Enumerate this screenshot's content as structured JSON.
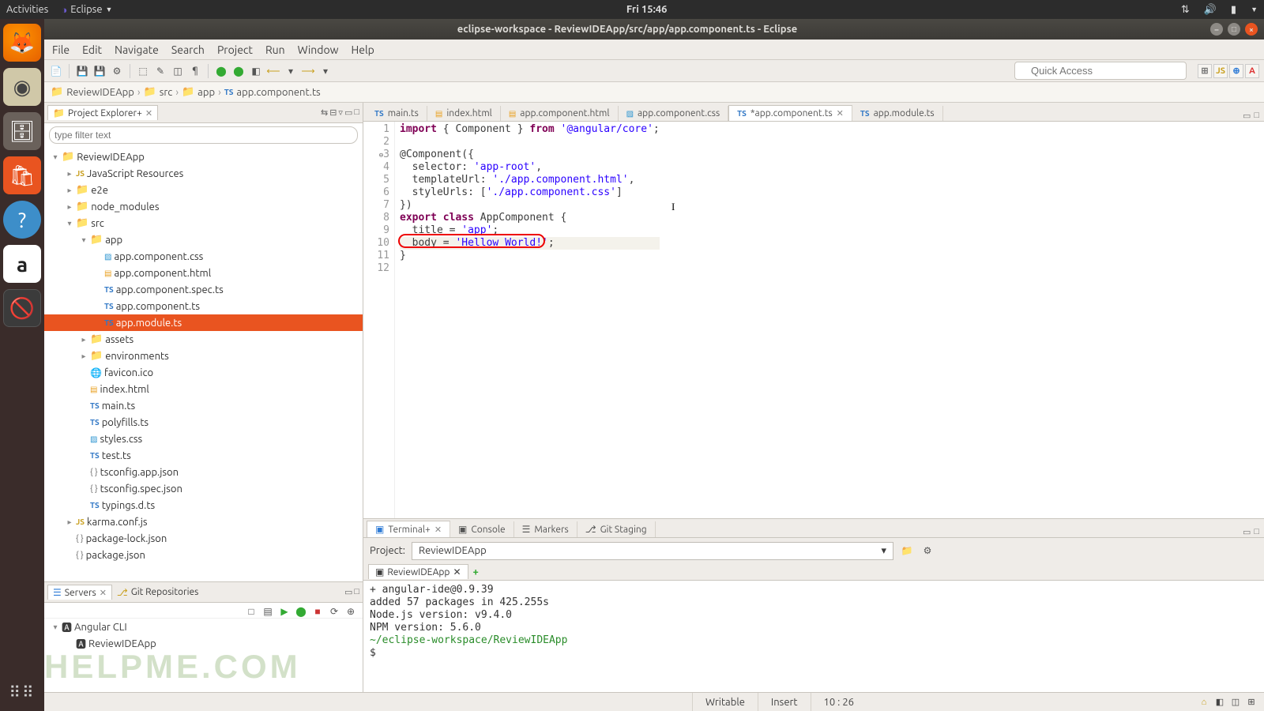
{
  "gnome": {
    "activities": "Activities",
    "app_indicator": "Eclipse",
    "clock": "Fri 15:46"
  },
  "titlebar": "eclipse-workspace - ReviewIDEApp/src/app/app.component.ts - Eclipse",
  "menubar": [
    "File",
    "Edit",
    "Navigate",
    "Search",
    "Project",
    "Run",
    "Window",
    "Help"
  ],
  "quick_access": "Quick Access",
  "perspectives": [
    "⊞",
    "JS",
    "⊕",
    "A"
  ],
  "breadcrumb": [
    "ReviewIDEApp",
    "src",
    "app",
    "app.component.ts"
  ],
  "project_explorer": {
    "label": "Project Explorer+",
    "filter_placeholder": "type filter text",
    "tree": [
      {
        "d": 0,
        "tw": "▾",
        "ic": "fold",
        "t": "ReviewIDEApp"
      },
      {
        "d": 1,
        "tw": "▸",
        "ic": "js",
        "t": "JavaScript Resources"
      },
      {
        "d": 1,
        "tw": "▸",
        "ic": "fold",
        "t": "e2e"
      },
      {
        "d": 1,
        "tw": "▸",
        "ic": "fold",
        "t": "node_modules"
      },
      {
        "d": 1,
        "tw": "▾",
        "ic": "fold",
        "t": "src"
      },
      {
        "d": 2,
        "tw": "▾",
        "ic": "fold",
        "t": "app"
      },
      {
        "d": 3,
        "tw": "",
        "ic": "css",
        "t": "app.component.css"
      },
      {
        "d": 3,
        "tw": "",
        "ic": "html",
        "t": "app.component.html"
      },
      {
        "d": 3,
        "tw": "",
        "ic": "ts",
        "t": "app.component.spec.ts"
      },
      {
        "d": 3,
        "tw": "",
        "ic": "ts",
        "t": "app.component.ts"
      },
      {
        "d": 3,
        "tw": "",
        "ic": "ts",
        "t": "app.module.ts",
        "sel": true
      },
      {
        "d": 2,
        "tw": "▸",
        "ic": "fold",
        "t": "assets"
      },
      {
        "d": 2,
        "tw": "▸",
        "ic": "fold",
        "t": "environments"
      },
      {
        "d": 2,
        "tw": "",
        "ic": "glob",
        "t": "favicon.ico"
      },
      {
        "d": 2,
        "tw": "",
        "ic": "html",
        "t": "index.html"
      },
      {
        "d": 2,
        "tw": "",
        "ic": "ts",
        "t": "main.ts"
      },
      {
        "d": 2,
        "tw": "",
        "ic": "ts",
        "t": "polyfills.ts"
      },
      {
        "d": 2,
        "tw": "",
        "ic": "css",
        "t": "styles.css"
      },
      {
        "d": 2,
        "tw": "",
        "ic": "ts",
        "t": "test.ts"
      },
      {
        "d": 2,
        "tw": "",
        "ic": "json",
        "t": "tsconfig.app.json"
      },
      {
        "d": 2,
        "tw": "",
        "ic": "json",
        "t": "tsconfig.spec.json"
      },
      {
        "d": 2,
        "tw": "",
        "ic": "ts",
        "t": "typings.d.ts"
      },
      {
        "d": 1,
        "tw": "▸",
        "ic": "js",
        "t": "karma.conf.js"
      },
      {
        "d": 1,
        "tw": "",
        "ic": "json",
        "t": "package-lock.json"
      },
      {
        "d": 1,
        "tw": "",
        "ic": "json",
        "t": "package.json"
      }
    ]
  },
  "servers_view": {
    "tabs": [
      "Servers",
      "Git Repositories"
    ],
    "rows": [
      {
        "d": 0,
        "tw": "▾",
        "ic": "ang",
        "t": "Angular CLI"
      },
      {
        "d": 1,
        "tw": "",
        "ic": "ang",
        "t": "ReviewIDEApp"
      }
    ]
  },
  "editor_tabs": [
    {
      "ic": "ts",
      "t": "main.ts"
    },
    {
      "ic": "html",
      "t": "index.html"
    },
    {
      "ic": "html",
      "t": "app.component.html"
    },
    {
      "ic": "css",
      "t": "app.component.css"
    },
    {
      "ic": "ts",
      "t": "*app.component.ts",
      "active": true
    },
    {
      "ic": "ts",
      "t": "app.module.ts"
    }
  ],
  "code_lines": [
    [
      {
        "k": "kw",
        "t": "import"
      },
      {
        "t": " { Component } "
      },
      {
        "k": "kw",
        "t": "from"
      },
      {
        "t": " "
      },
      {
        "k": "str",
        "t": "'@angular/core'"
      },
      {
        "t": ";"
      }
    ],
    [],
    [
      {
        "t": "@Component({"
      }
    ],
    [
      {
        "t": "  selector: "
      },
      {
        "k": "str",
        "t": "'app-root'"
      },
      {
        "t": ","
      }
    ],
    [
      {
        "t": "  templateUrl: "
      },
      {
        "k": "str",
        "t": "'./app.component.html'"
      },
      {
        "t": ","
      }
    ],
    [
      {
        "t": "  styleUrls: ["
      },
      {
        "k": "str",
        "t": "'./app.component.css'"
      },
      {
        "t": "]"
      }
    ],
    [
      {
        "t": "})"
      }
    ],
    [
      {
        "k": "kw",
        "t": "export"
      },
      {
        "t": " "
      },
      {
        "k": "kw",
        "t": "class"
      },
      {
        "t": " AppComponent {"
      }
    ],
    [
      {
        "t": "  title = "
      },
      {
        "k": "str",
        "t": "'app'"
      },
      {
        "t": ";"
      }
    ],
    [
      {
        "t": "  body = "
      },
      {
        "k": "str",
        "t": "'Hellow World!'"
      },
      {
        "t": ";"
      }
    ],
    [
      {
        "t": "}"
      }
    ],
    []
  ],
  "gutter_annotations": {
    "3": "⊖"
  },
  "terminal": {
    "tabs": [
      "Terminal+",
      "Console",
      "Markers",
      "Git Staging"
    ],
    "project_label": "Project:",
    "project_value": "ReviewIDEApp",
    "inner_tab": "ReviewIDEApp",
    "lines": [
      "+ angular-ide@0.9.39",
      "added 57 packages in 425.255s",
      "Node.js version:    v9.4.0",
      "NPM version:        5.6.0",
      "",
      "~/eclipse-workspace/ReviewIDEApp",
      "$"
    ]
  },
  "statusbar": {
    "writable": "Writable",
    "insert": "Insert",
    "pos": "10 : 26"
  },
  "watermark": "HELPME.COM"
}
